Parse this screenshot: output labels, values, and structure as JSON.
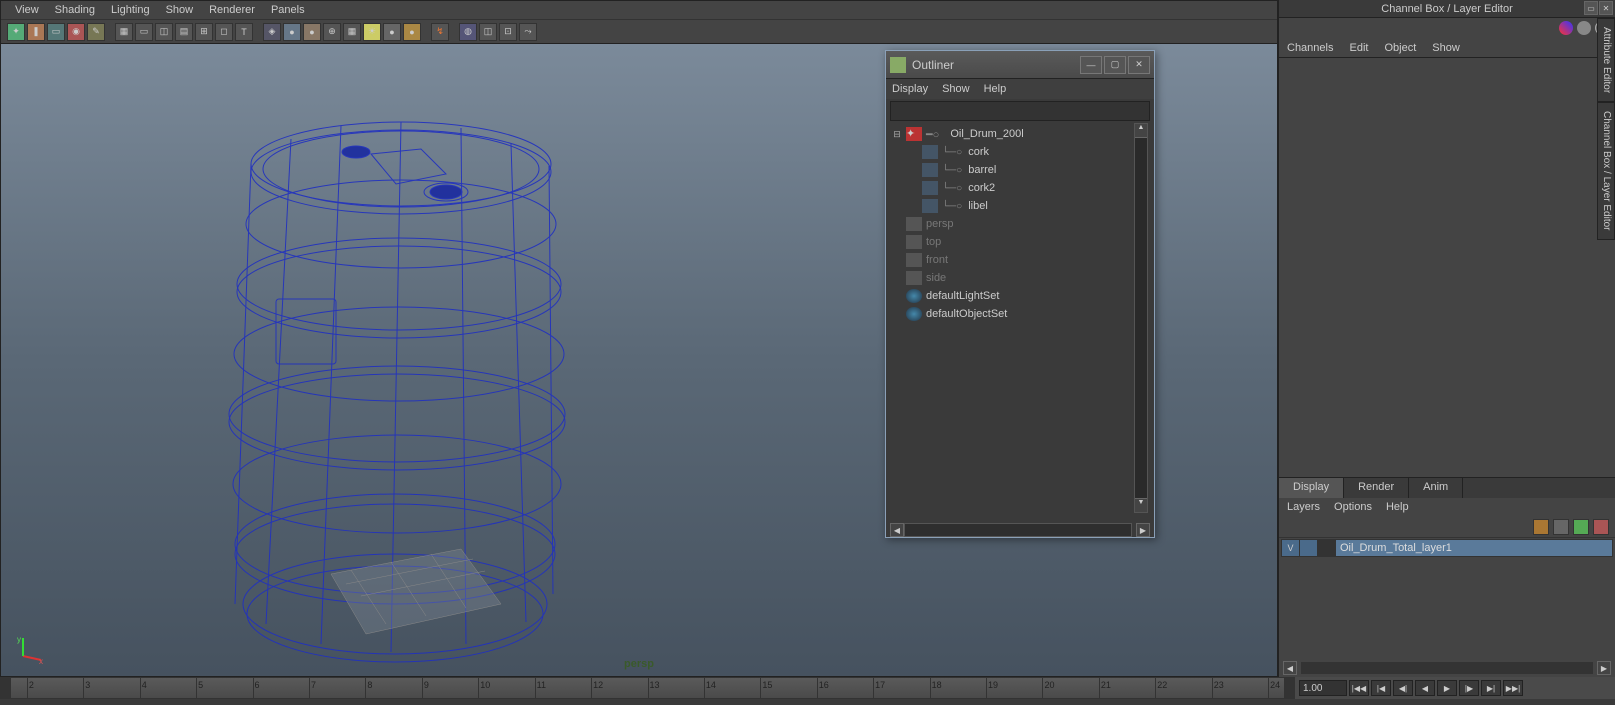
{
  "viewport": {
    "menus": [
      "View",
      "Shading",
      "Lighting",
      "Show",
      "Renderer",
      "Panels"
    ],
    "camera_label": "persp",
    "axes": [
      "x",
      "y"
    ]
  },
  "outliner": {
    "title": "Outliner",
    "menus": [
      "Display",
      "Show",
      "Help"
    ],
    "root": {
      "name": "Oil_Drum_200l"
    },
    "children": [
      "cork",
      "barrel",
      "cork2",
      "libel"
    ],
    "cameras": [
      "persp",
      "top",
      "front",
      "side"
    ],
    "sets": [
      "defaultLightSet",
      "defaultObjectSet"
    ]
  },
  "channel_box": {
    "title": "Channel Box / Layer Editor",
    "tabs": [
      "Channels",
      "Edit",
      "Object",
      "Show"
    ]
  },
  "layer_editor": {
    "tabs": [
      "Display",
      "Render",
      "Anim"
    ],
    "active_tab": "Display",
    "menus": [
      "Layers",
      "Options",
      "Help"
    ],
    "layers": [
      {
        "vis": "V",
        "name": "Oil_Drum_Total_layer1"
      }
    ]
  },
  "side_tabs": [
    "Attribute Editor",
    "Channel Box / Layer Editor"
  ],
  "timeline": {
    "ticks": [
      "2",
      "3",
      "4",
      "5",
      "6",
      "7",
      "8",
      "9",
      "10",
      "11",
      "12",
      "13",
      "14",
      "15",
      "16",
      "17",
      "18",
      "19",
      "20",
      "21",
      "22",
      "23",
      "24"
    ],
    "current": "1.00"
  },
  "playback": {
    "buttons": [
      "|◀◀",
      "|◀",
      "◀|",
      "◀",
      "▶",
      "▶|",
      "▶|",
      "▶▶|"
    ]
  }
}
